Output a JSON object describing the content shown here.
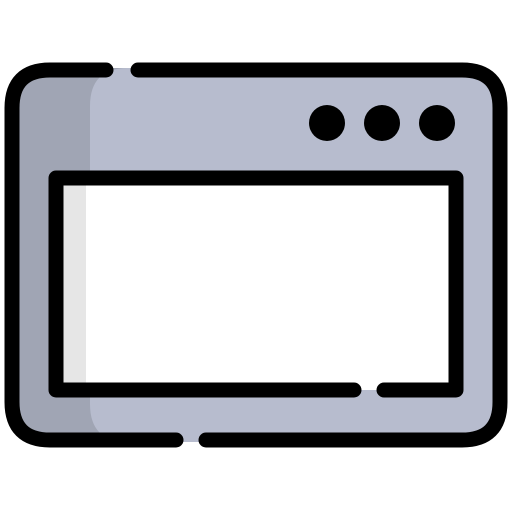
{
  "icon": {
    "name": "browser-window-icon",
    "colors": {
      "frame_fill": "#B7BCCE",
      "frame_shadow": "#A0A5B4",
      "content_fill": "#FFFFFF",
      "content_shadow": "#E6E6E6",
      "stroke": "#000000"
    },
    "controls": [
      "window-dot-icon",
      "window-dot-icon",
      "window-dot-icon"
    ]
  }
}
